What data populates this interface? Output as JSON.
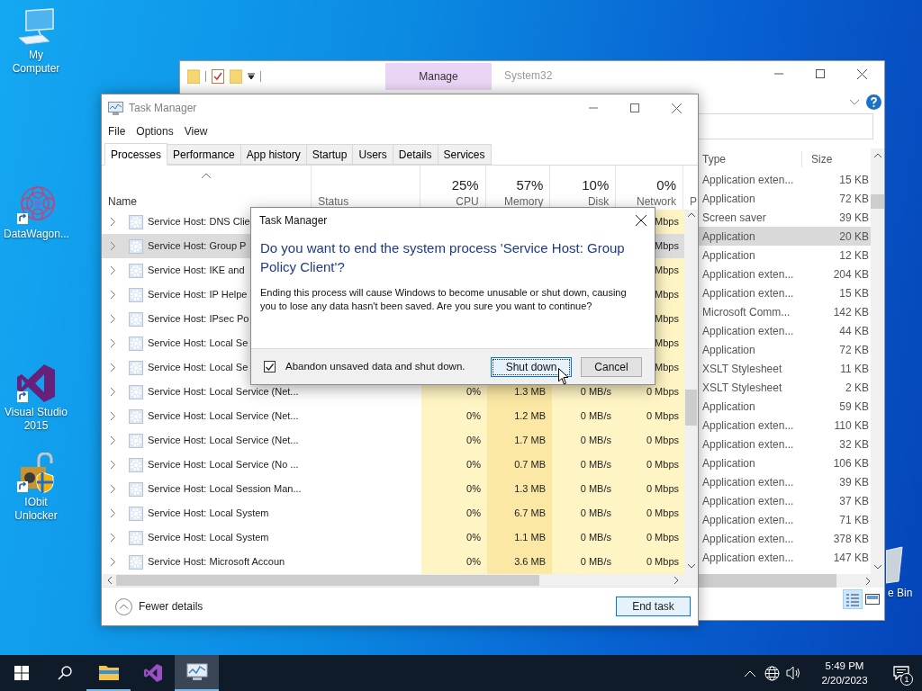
{
  "desktop_icons": [
    {
      "kind": "computer",
      "label": "My Computer"
    },
    {
      "kind": "mandala",
      "label": "DataWagon..."
    },
    {
      "kind": "visual-studio",
      "label": "Visual Studio 2015"
    },
    {
      "kind": "unlocker",
      "label": "IObit Unlocker"
    },
    {
      "kind": "recycle-bin",
      "label": "e Bin"
    }
  ],
  "explorer": {
    "ribbon_tab": "Manage",
    "title": "System32",
    "columns": [
      "Type",
      "Size"
    ],
    "rows": [
      {
        "type": "Application exten...",
        "size": "15 KB",
        "selected": false
      },
      {
        "type": "Application",
        "size": "72 KB",
        "selected": false
      },
      {
        "type": "Screen saver",
        "size": "39 KB",
        "selected": false
      },
      {
        "type": "Application",
        "size": "20 KB",
        "selected": true
      },
      {
        "type": "Application",
        "size": "12 KB",
        "selected": false
      },
      {
        "type": "Application exten...",
        "size": "204 KB",
        "selected": false
      },
      {
        "type": "Application exten...",
        "size": "15 KB",
        "selected": false
      },
      {
        "type": "Microsoft Comm...",
        "size": "142 KB",
        "selected": false
      },
      {
        "type": "Application exten...",
        "size": "44 KB",
        "selected": false
      },
      {
        "type": "Application",
        "size": "72 KB",
        "selected": false
      },
      {
        "type": "XSLT Stylesheet",
        "size": "11 KB",
        "selected": false
      },
      {
        "type": "XSLT Stylesheet",
        "size": "2 KB",
        "selected": false
      },
      {
        "type": "Application",
        "size": "59 KB",
        "selected": false
      },
      {
        "type": "Application exten...",
        "size": "110 KB",
        "selected": false
      },
      {
        "type": "Application exten...",
        "size": "32 KB",
        "selected": false
      },
      {
        "type": "Application",
        "size": "106 KB",
        "selected": false
      },
      {
        "type": "Application exten...",
        "size": "39 KB",
        "selected": false
      },
      {
        "type": "Application exten...",
        "size": "37 KB",
        "selected": false
      },
      {
        "type": "Application exten...",
        "size": "71 KB",
        "selected": false
      },
      {
        "type": "Application exten...",
        "size": "378 KB",
        "selected": false
      },
      {
        "type": "Application exten...",
        "size": "147 KB",
        "selected": false
      }
    ]
  },
  "task_manager": {
    "title": "Task Manager",
    "menu": [
      "File",
      "Options",
      "View"
    ],
    "tabs": [
      {
        "label": "Processes",
        "selected": true
      },
      {
        "label": "Performance",
        "selected": false
      },
      {
        "label": "App history",
        "selected": false
      },
      {
        "label": "Startup",
        "selected": false
      },
      {
        "label": "Users",
        "selected": false
      },
      {
        "label": "Details",
        "selected": false
      },
      {
        "label": "Services",
        "selected": false
      }
    ],
    "columns": [
      {
        "label": "Name",
        "sorted": true
      },
      {
        "label": "Status",
        "sorted": false
      },
      {
        "label": "CPU",
        "percent": "25%",
        "sorted": false
      },
      {
        "label": "Memory",
        "percent": "57%",
        "sorted": false
      },
      {
        "label": "Disk",
        "percent": "10%",
        "sorted": false
      },
      {
        "label": "Network",
        "percent": "0%",
        "sorted": false
      },
      {
        "label": "P",
        "sorted": false
      }
    ],
    "rows": [
      {
        "name": "Service Host: DNS Clie",
        "network": "Mbps",
        "selected": false
      },
      {
        "name": "Service Host: Group P",
        "network": "Mbps",
        "selected": true
      },
      {
        "name": "Service Host: IKE and",
        "network": "Mbps",
        "selected": false
      },
      {
        "name": "Service Host: IP Helpe",
        "network": "Mbps",
        "selected": false
      },
      {
        "name": "Service Host: IPsec Po",
        "network": "Mbps",
        "selected": false
      },
      {
        "name": "Service Host: Local Se",
        "network": "Mbps",
        "selected": false
      },
      {
        "name": "Service Host: Local Se",
        "network": "Mbps",
        "selected": false
      },
      {
        "name": "Service Host: Local Service (Net...",
        "cpu": "0%",
        "memory": "1.3 MB",
        "disk": "0 MB/s",
        "network": "0 Mbps",
        "selected": false
      },
      {
        "name": "Service Host: Local Service (Net...",
        "cpu": "0%",
        "memory": "1.2 MB",
        "disk": "0 MB/s",
        "network": "0 Mbps",
        "selected": false
      },
      {
        "name": "Service Host: Local Service (Net...",
        "cpu": "0%",
        "memory": "1.7 MB",
        "disk": "0 MB/s",
        "network": "0 Mbps",
        "selected": false
      },
      {
        "name": "Service Host: Local Service (No ...",
        "cpu": "0%",
        "memory": "0.7 MB",
        "disk": "0 MB/s",
        "network": "0 Mbps",
        "selected": false
      },
      {
        "name": "Service Host: Local Session Man...",
        "cpu": "0%",
        "memory": "1.3 MB",
        "disk": "0 MB/s",
        "network": "0 Mbps",
        "selected": false
      },
      {
        "name": "Service Host: Local System",
        "cpu": "0%",
        "memory": "6.7 MB",
        "disk": "0 MB/s",
        "network": "0 Mbps",
        "selected": false
      },
      {
        "name": "Service Host: Local System",
        "cpu": "0%",
        "memory": "1.1 MB",
        "disk": "0 MB/s",
        "network": "0 Mbps",
        "selected": false
      },
      {
        "name": "Service Host: Microsoft Accoun",
        "cpu": "0%",
        "memory": "3.6 MB",
        "disk": "0 MB/s",
        "network": "0 Mbps",
        "selected": false
      }
    ],
    "fewer_details": "Fewer details",
    "end_task": "End task"
  },
  "dialog": {
    "title": "Task Manager",
    "heading": "Do you want to end the system process 'Service Host: Group Policy Client'?",
    "message": "Ending this process will cause Windows to become unusable or shut down, causing you to lose any data hasn't been saved. Are you sure you want to continue?",
    "checkbox": {
      "label": "Abandon unsaved data and shut down.",
      "checked": true
    },
    "buttons": [
      "Shut down",
      "Cancel"
    ]
  },
  "taskbar": {
    "apps": [
      {
        "kind": "explorer",
        "running": true,
        "selected": false
      },
      {
        "kind": "visual-studio",
        "running": false,
        "selected": false
      },
      {
        "kind": "task-manager",
        "running": true,
        "selected": true
      }
    ],
    "time": "5:49 PM",
    "date": "2/20/2023",
    "notifications": "1"
  }
}
